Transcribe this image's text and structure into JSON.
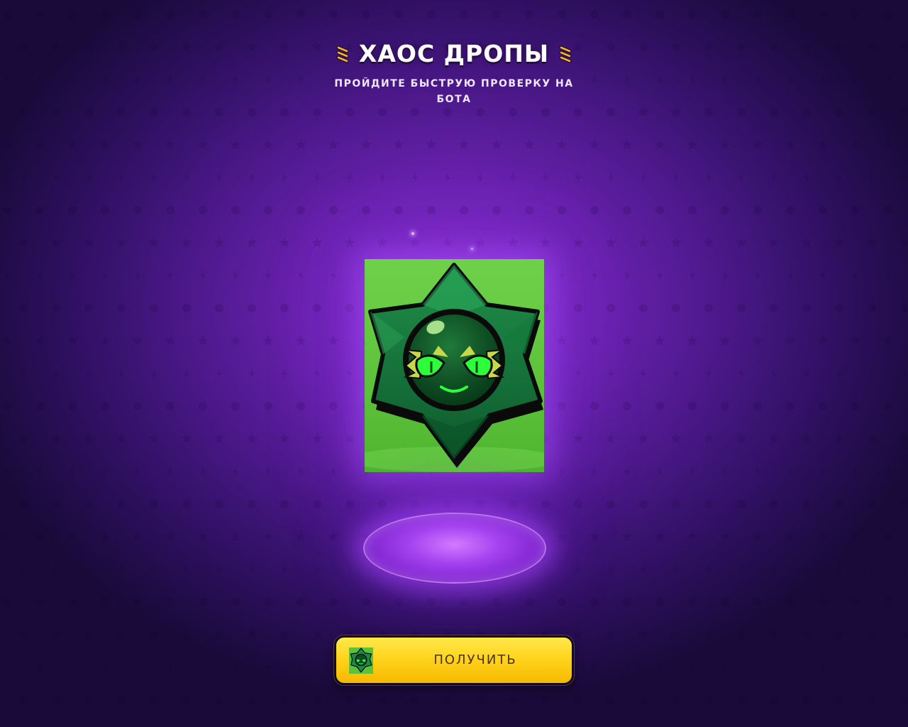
{
  "header": {
    "title": "ХАОС ДРОПЫ",
    "subtitle": "ПРОЙДИТЕ БЫСТРУЮ ПРОВЕРКУ НА БОТА",
    "left_icon": "lightning-icon",
    "right_icon": "lightning-icon"
  },
  "reward": {
    "icon": "chaos-star-drop-icon",
    "card_color": "#5cc23a"
  },
  "claim_button": {
    "label": "ПОЛУЧИТЬ",
    "icon": "chaos-star-drop-icon",
    "color": "#ffd21a"
  },
  "colors": {
    "background": "#4a1888",
    "accent": "#a542f0"
  }
}
